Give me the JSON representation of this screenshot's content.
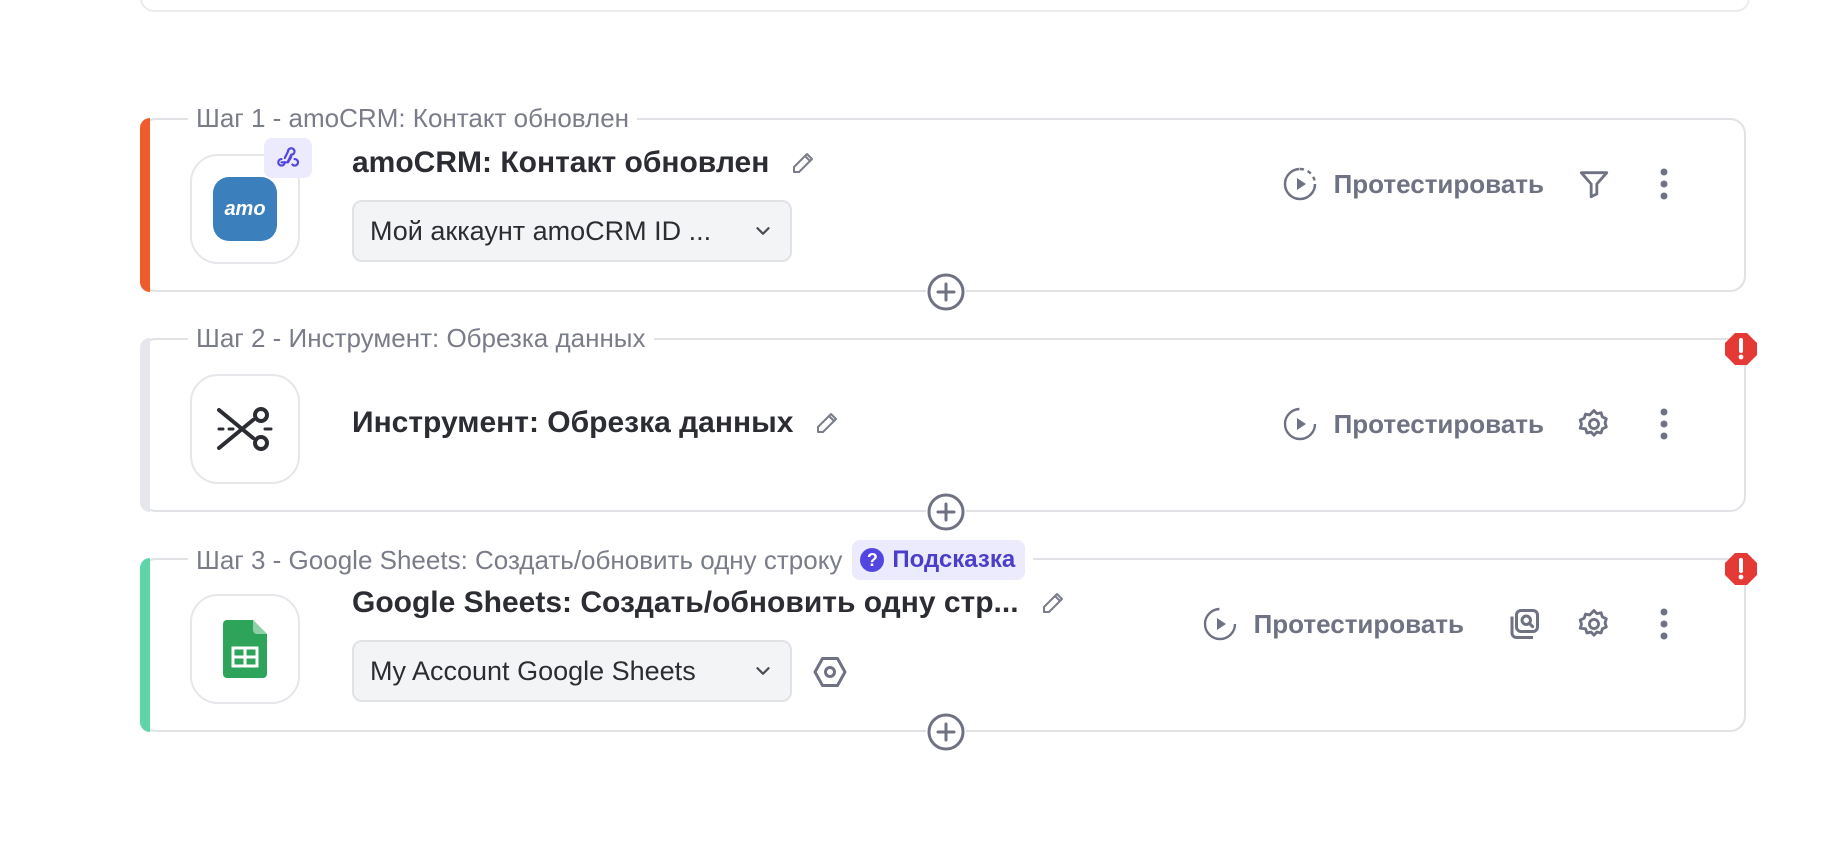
{
  "steps": [
    {
      "legend": "Шаг 1 - amoCRM: Контакт обновлен",
      "title": "amoCRM: Контакт обновлен",
      "account": "Мой аккаунт amoCRM ID ...",
      "app_logo_text": "amo",
      "test_label": "Протестировать",
      "accent_color": "#ef5b2a",
      "icons": [
        "webhook-icon",
        "filter-icon",
        "more-vertical-icon"
      ]
    },
    {
      "legend": "Шаг 2 - Инструмент: Обрезка данных",
      "title": "Инструмент: Обрезка данных",
      "test_label": "Протестировать",
      "accent_color": "#e6e7ec",
      "icons": [
        "scissors-icon",
        "gear-icon",
        "more-vertical-icon",
        "alert-icon"
      ]
    },
    {
      "legend": "Шаг 3 - Google Sheets: Создать/обновить одну строку",
      "hint_label": "Подсказка",
      "title": "Google Sheets: Создать/обновить одну стр...",
      "account": "My Account Google Sheets",
      "test_label": "Протестировать",
      "accent_color": "#5fd4a9",
      "icons": [
        "google-sheets-icon",
        "settings-hexagon-icon",
        "search-copy-icon",
        "gear-icon",
        "more-vertical-icon",
        "alert-icon"
      ]
    }
  ],
  "colors": {
    "amocrm_blue": "#3b80bd",
    "sheets_green": "#2ea35a",
    "alert_red": "#e53935",
    "hint_purple": "#5147e0"
  }
}
